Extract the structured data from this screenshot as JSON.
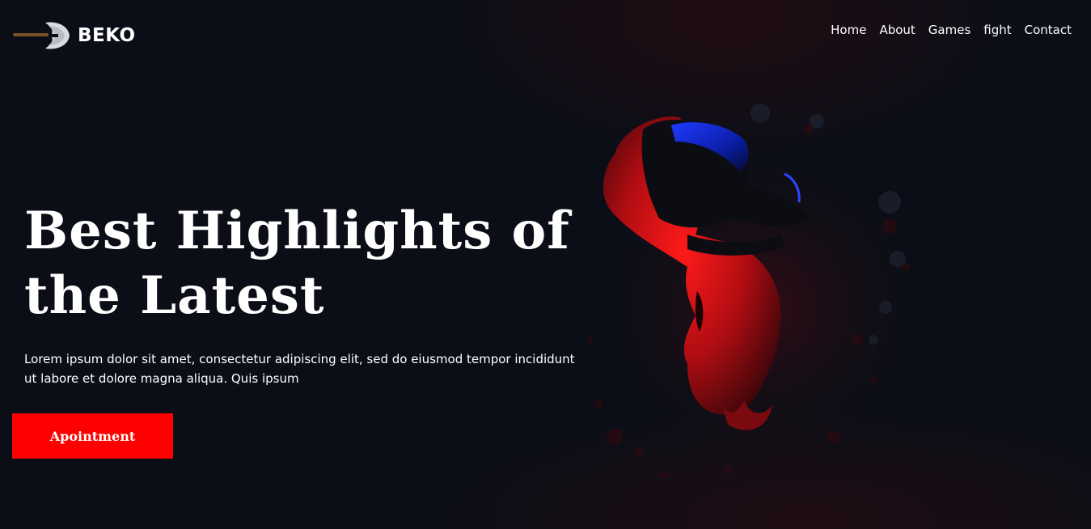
{
  "brand": {
    "name": "BEKO",
    "logo_icon": "battle-axe-icon"
  },
  "nav": {
    "items": [
      {
        "label": "Home"
      },
      {
        "label": "About"
      },
      {
        "label": "Games"
      },
      {
        "label": "fight"
      },
      {
        "label": "Contact"
      }
    ]
  },
  "hero": {
    "title_line1": "Best Highlights of",
    "title_line2": "the Latest",
    "description": "Lorem ipsum dolor sit amet, consectetur adipiscing elit, sed do eiusmod tempor incididunt ut labore et dolore magna aliqua. Quis ipsum",
    "cta_label": "Apointment",
    "image_subject": "vr-headset-face-image"
  },
  "colors": {
    "background": "#0b0e17",
    "accent": "#ff0000",
    "text": "#ffffff"
  }
}
